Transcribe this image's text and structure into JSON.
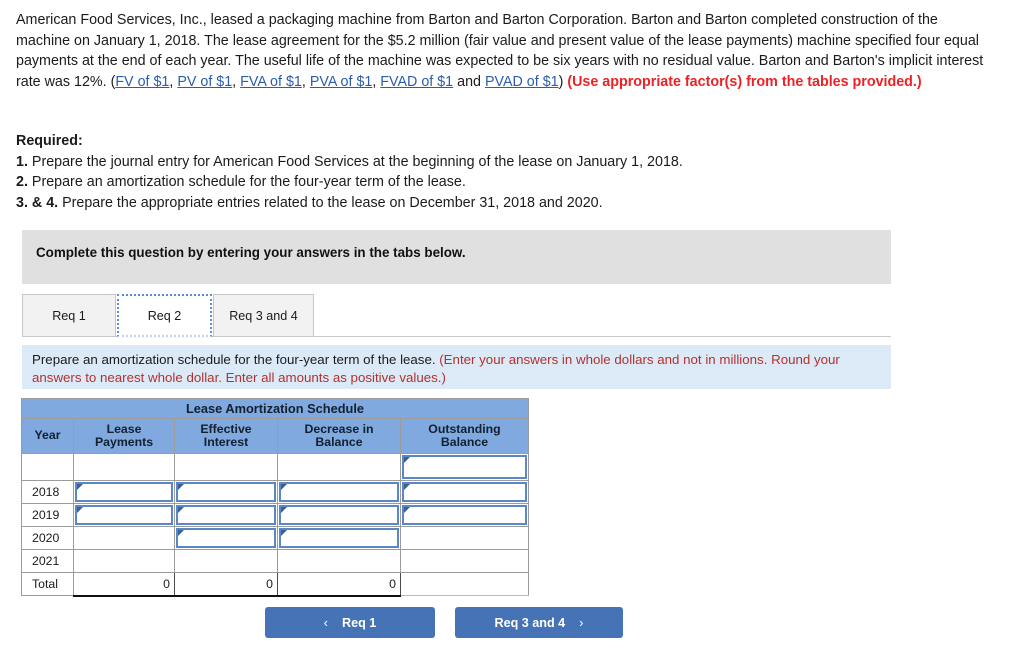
{
  "problem": {
    "part1": "American Food Services, Inc., leased a packaging machine from Barton and Barton Corporation. Barton and Barton completed construction of the machine on January 1, 2018. The lease agreement for the $5.2 million (fair value and present value of the lease payments) machine specified four equal payments at the end of each year. The useful life of the machine was expected to be six years with no residual value. Barton and Barton's implicit interest rate was 12%. (",
    "links": [
      "FV of $1",
      "PV of $1",
      "FVA of $1",
      "PVA of $1",
      "FVAD of $1",
      "PVAD of $1"
    ],
    "sep": ", ",
    "and_word": " and ",
    "close_paren": ") ",
    "emphasis": "(Use appropriate factor(s) from the tables provided.)"
  },
  "required": {
    "heading": "Required:",
    "items": [
      {
        "num": "1.",
        "text": " Prepare the journal entry for American Food Services at the beginning of the lease on January 1, 2018."
      },
      {
        "num": "2.",
        "text": " Prepare an amortization schedule for the four-year term of the lease."
      },
      {
        "num": "3. & 4.",
        "text": " Prepare the appropriate entries related to the lease on December 31, 2018 and 2020."
      }
    ]
  },
  "gray_bar": {
    "text": "Complete this question by entering your answers in the tabs below."
  },
  "tabs": {
    "items": [
      {
        "label": "Req 1",
        "active": false
      },
      {
        "label": "Req 2",
        "active": true
      },
      {
        "label": "Req 3 and 4",
        "active": false
      }
    ]
  },
  "instruction": {
    "black": "Prepare an amortization schedule for the four-year term of the lease. ",
    "red": "(Enter your answers in whole dollars and not in millions. Round your answers to nearest whole dollar. Enter all amounts as positive values.)"
  },
  "table": {
    "title": "Lease Amortization Schedule",
    "columns": [
      "Year",
      "Lease Payments",
      "Effective Interest",
      "Decrease in Balance",
      "Outstanding Balance"
    ],
    "columns_split": [
      {
        "l1": "Year",
        "l2": ""
      },
      {
        "l1": "Lease",
        "l2": "Payments"
      },
      {
        "l1": "Effective",
        "l2": "Interest"
      },
      {
        "l1": "Decrease in",
        "l2": "Balance"
      },
      {
        "l1": "Outstanding",
        "l2": "Balance"
      }
    ],
    "rows": [
      {
        "year": "",
        "payments": "",
        "interest": "",
        "decrease": "",
        "outstanding": "",
        "inputs": {
          "payments": false,
          "interest": false,
          "decrease": false,
          "outstanding": true
        }
      },
      {
        "year": "2018",
        "payments": "",
        "interest": "",
        "decrease": "",
        "outstanding": "",
        "inputs": {
          "payments": true,
          "interest": true,
          "decrease": true,
          "outstanding": true
        }
      },
      {
        "year": "2019",
        "payments": "",
        "interest": "",
        "decrease": "",
        "outstanding": "",
        "inputs": {
          "payments": true,
          "interest": true,
          "decrease": true,
          "outstanding": true
        }
      },
      {
        "year": "2020",
        "payments": "",
        "interest": "",
        "decrease": "",
        "outstanding": "",
        "inputs": {
          "payments": false,
          "interest": true,
          "decrease": true,
          "outstanding": false
        }
      },
      {
        "year": "2021",
        "payments": "",
        "interest": "",
        "decrease": "",
        "outstanding": "",
        "inputs": {
          "payments": false,
          "interest": false,
          "decrease": false,
          "outstanding": false
        }
      }
    ],
    "total_row": {
      "label": "Total",
      "payments": "0",
      "interest": "0",
      "decrease": "0",
      "outstanding": ""
    }
  },
  "nav": {
    "prev_label": "Req 1",
    "prev_icon": "chevron-left",
    "prev_glyph": "‹",
    "next_label": "Req 3 and 4",
    "next_icon": "chevron-right",
    "next_glyph": "›"
  },
  "colors": {
    "button_blue": "#4573b5",
    "table_header_blue": "#7fa9df",
    "instruction_band": "#dce9f7",
    "gray_band": "#e0e0e0",
    "link_blue": "#2a5db0",
    "red_emphasis": "#ec2227",
    "instruction_red": "#b3322e"
  }
}
